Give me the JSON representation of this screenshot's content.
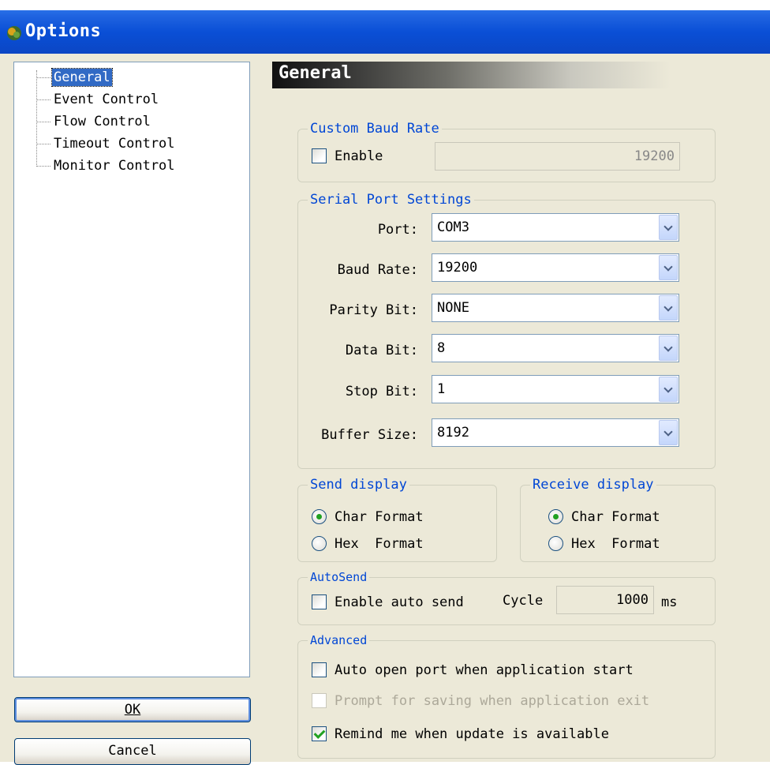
{
  "window": {
    "title": "Options"
  },
  "tree": {
    "items": [
      {
        "label": "General",
        "selected": true
      },
      {
        "label": "Event Control"
      },
      {
        "label": "Flow Control"
      },
      {
        "label": "Timeout Control"
      },
      {
        "label": "Monitor Control"
      }
    ]
  },
  "buttons": {
    "ok": "OK",
    "cancel": "Cancel"
  },
  "section": {
    "title": "General"
  },
  "custom_baud": {
    "legend": "Custom Baud Rate",
    "enable_label": "Enable",
    "enabled": false,
    "value": "19200"
  },
  "serial": {
    "legend": "Serial Port Settings",
    "fields": [
      {
        "label": "Port:",
        "value": "COM3"
      },
      {
        "label": "Baud Rate:",
        "value": "19200"
      },
      {
        "label": "Parity Bit:",
        "value": "NONE"
      },
      {
        "label": "Data Bit:",
        "value": "8"
      },
      {
        "label": "Stop Bit:",
        "value": "1"
      },
      {
        "label": "Buffer Size:",
        "value": "8192"
      }
    ]
  },
  "send_display": {
    "legend": "Send display",
    "char": "Char Format",
    "hex": "Hex  Format",
    "selected": "char"
  },
  "receive_display": {
    "legend": "Receive display",
    "char": "Char Format",
    "hex": "Hex  Format",
    "selected": "char"
  },
  "autosend": {
    "legend": "AutoSend",
    "enable_label": "Enable auto send",
    "enabled": false,
    "cycle_label": "Cycle",
    "cycle_value": "1000",
    "unit": "ms"
  },
  "advanced": {
    "legend": "Advanced",
    "options": [
      {
        "label": "Auto open port when application start",
        "checked": false,
        "enabled": true
      },
      {
        "label": "Prompt for saving when application exit",
        "checked": false,
        "enabled": false
      },
      {
        "label": "Remind me when update is available",
        "checked": true,
        "enabled": true
      }
    ]
  },
  "colors": {
    "titlebar": "#0a4fd6",
    "selection": "#316ac5",
    "legend": "#0046d5",
    "check": "#21a121"
  }
}
